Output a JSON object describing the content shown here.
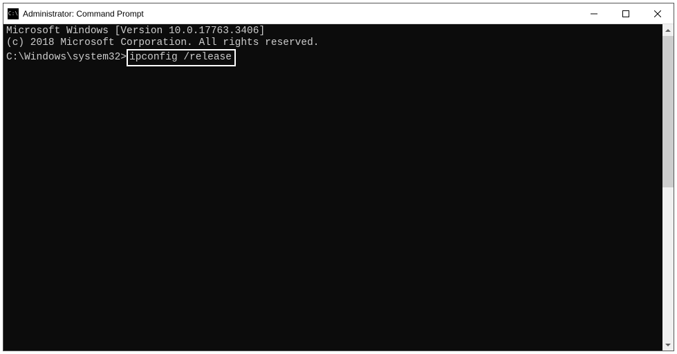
{
  "window": {
    "icon_label": "C:\\",
    "title": "Administrator: Command Prompt"
  },
  "controls": {
    "minimize": "Minimize",
    "maximize": "Maximize",
    "close": "Close"
  },
  "console": {
    "line1": "Microsoft Windows [Version 10.0.17763.3406]",
    "line2": "(c) 2018 Microsoft Corporation. All rights reserved.",
    "blank": "",
    "prompt": "C:\\Windows\\system32>",
    "command": "ipconfig /release"
  }
}
